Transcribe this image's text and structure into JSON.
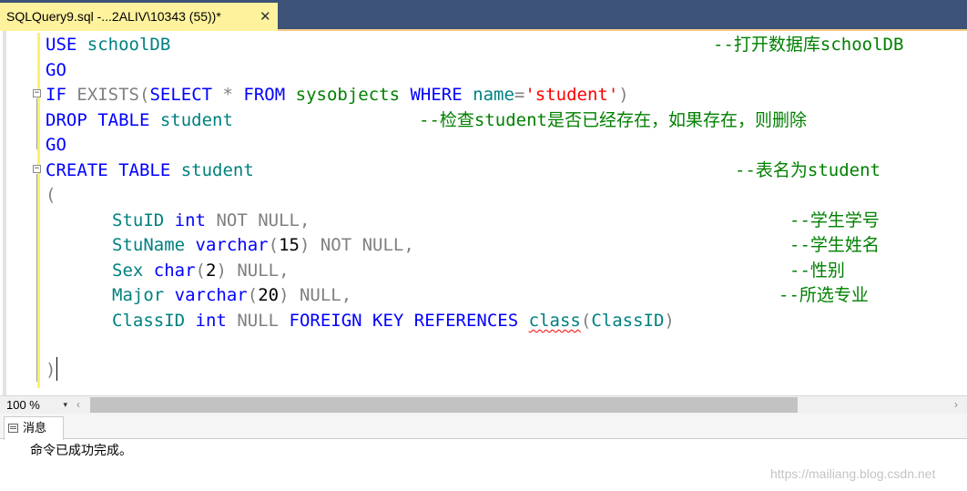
{
  "tab": {
    "title": "SQLQuery9.sql -...2ALIV\\10343 (55))*",
    "close": "✕"
  },
  "code": {
    "l1": {
      "kw": "USE",
      "name": "schoolDB",
      "comment": "--打开数据库schoolDB"
    },
    "l2": {
      "kw": "GO"
    },
    "l3": {
      "kw1": "IF",
      "kw2": "EXISTS",
      "p1": "(",
      "kw3": "SELECT",
      "star": " * ",
      "kw4": "FROM",
      "obj": "sysobjects",
      "kw5": "WHERE",
      "col": "name",
      "eq": "=",
      "str": "'student'",
      "p2": ")"
    },
    "l4": {
      "kw": "DROP TABLE",
      "name": "student",
      "comment": "--检查student是否已经存在，如果存在，则删除"
    },
    "l5": {
      "kw": "GO"
    },
    "l6": {
      "kw": "CREATE TABLE",
      "name": "student",
      "comment": "--表名为student"
    },
    "l7": {
      "open": "("
    },
    "l8": {
      "col": "StuID",
      "type": "int",
      "rest": "NOT NULL,",
      "comment": "--学生学号"
    },
    "l9": {
      "col": "StuName",
      "type": "varchar",
      "p": "(",
      "num": "15",
      "p2": ")",
      "rest": "NOT NULL,",
      "comment": "--学生姓名"
    },
    "l10": {
      "col": "Sex",
      "type": "char",
      "p": "(",
      "num": "2",
      "p2": ")",
      "rest": "NULL,",
      "comment": "--性别"
    },
    "l11": {
      "col": "Major",
      "type": "varchar",
      "p": "(",
      "num": "20",
      "p2": ")",
      "rest": "NULL,",
      "comment": "--所选专业"
    },
    "l12": {
      "col": "ClassID",
      "type": "int",
      "null": "NULL",
      "fk": "FOREIGN KEY REFERENCES",
      "ref": "class",
      "p": "(",
      "refcol": "ClassID",
      "p2": ")"
    },
    "l13": {
      "close": ")"
    }
  },
  "statusbar": {
    "zoom": "100 %",
    "zoom_arrow": "▾",
    "left": "‹",
    "right": "›"
  },
  "messages": {
    "tab_label": "消息",
    "text": "命令已成功完成。"
  },
  "watermark": "https://mailiang.blog.csdn.net"
}
